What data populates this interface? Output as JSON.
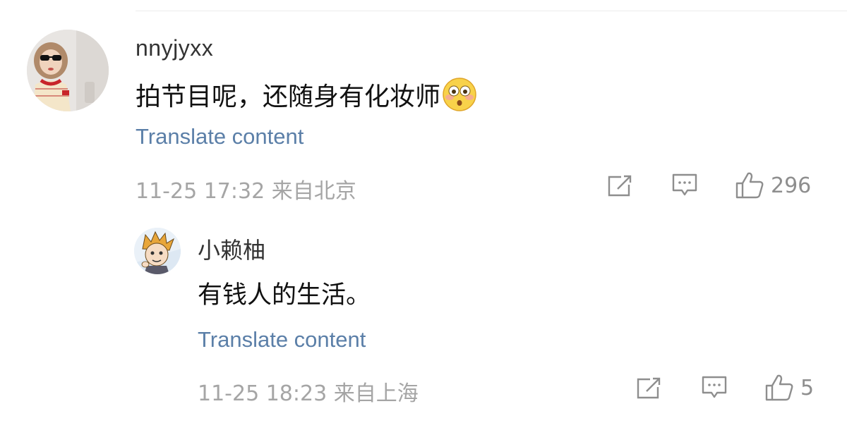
{
  "comments": [
    {
      "author": "nnyjyxx",
      "content": "拍节目呢，还随身有化妆师",
      "emoji": "flushed-face-emoji",
      "translate_label": "Translate content",
      "timestamp": "11-25 17:32",
      "location": "来自北京",
      "likes": "296"
    },
    {
      "author": "小赖柚",
      "content": "有钱人的生活。",
      "translate_label": "Translate content",
      "timestamp": "11-25 18:23",
      "location": "来自上海",
      "likes": "5"
    }
  ],
  "icons": {
    "share": "share-icon",
    "comment": "comment-icon",
    "like": "thumbs-up-icon"
  },
  "colors": {
    "link": "#5b7fa8",
    "meta": "#a5a5a5",
    "icon": "#8e8e8e",
    "text": "#111111"
  }
}
